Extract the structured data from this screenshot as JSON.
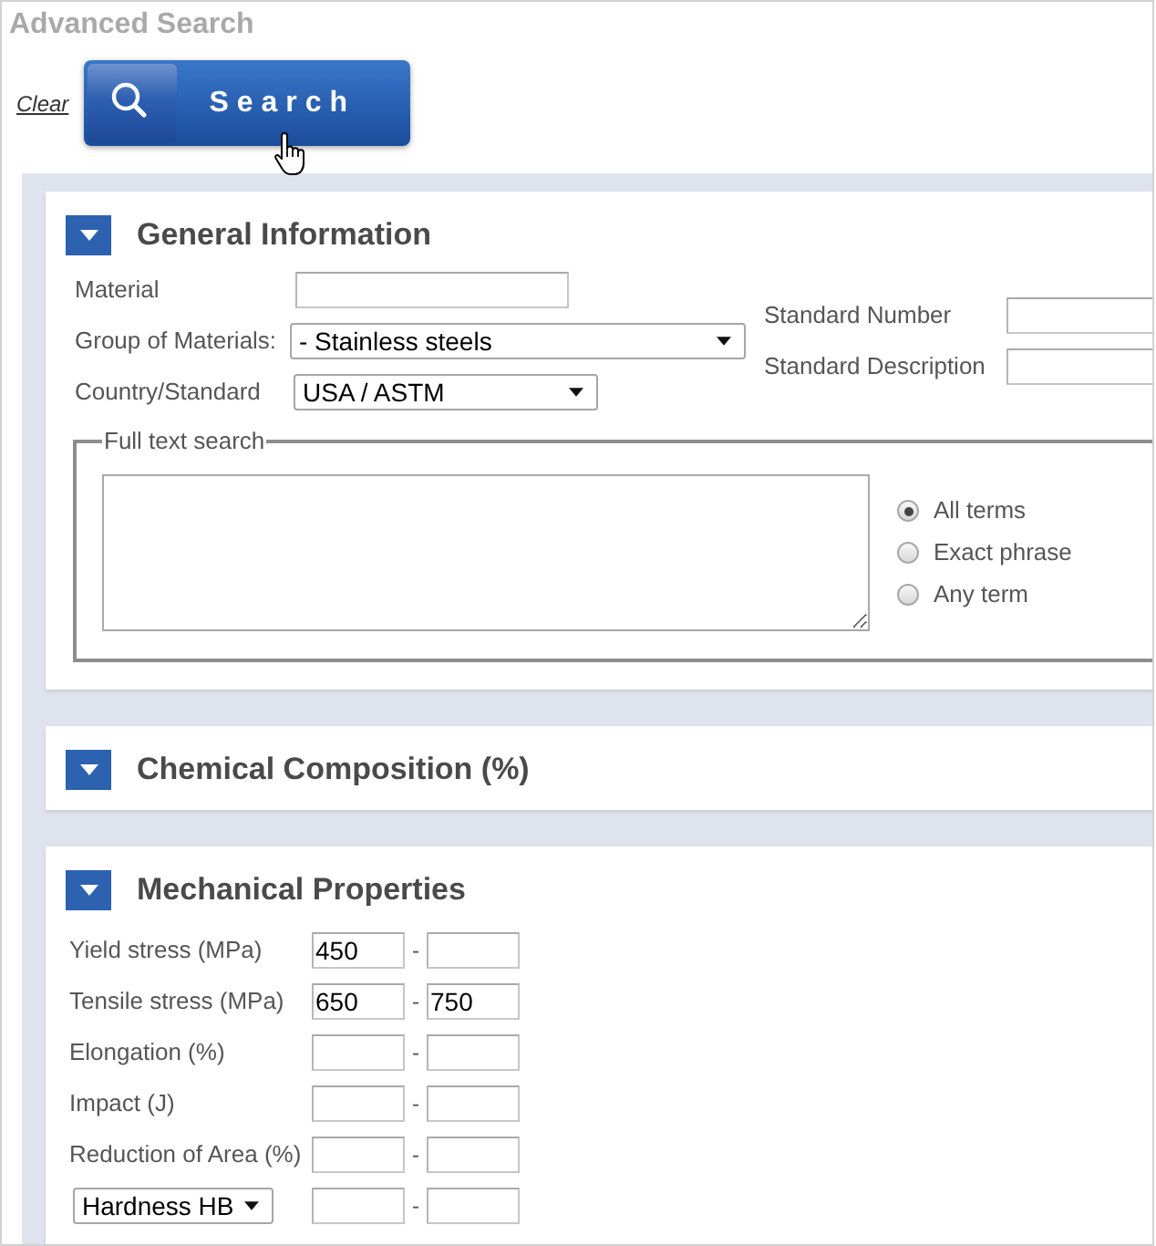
{
  "page": {
    "title": "Advanced Search"
  },
  "actions": {
    "clear_link": "Clear",
    "search_button": "Search"
  },
  "sections": [
    {
      "kind": "general",
      "title": "General Information",
      "fields": [
        {
          "kind": "text",
          "label": "Material"
        },
        {
          "kind": "select",
          "label": "Group of Materials:",
          "value": "- Stainless steels"
        },
        {
          "kind": "select",
          "label": "Country/Standard",
          "value": "USA / ASTM"
        }
      ],
      "standard_fields": [
        {
          "kind": "text",
          "label": "Standard Number"
        },
        {
          "kind": "text",
          "label": "Standard Description"
        }
      ],
      "full_text_search": {
        "legend": "Full text search",
        "options": [
          {
            "label": "All terms",
            "selected": true
          },
          {
            "label": "Exact phrase",
            "selected": false
          },
          {
            "label": "Any term",
            "selected": false
          }
        ]
      }
    },
    {
      "kind": "header_only",
      "title": "Chemical Composition (%)"
    },
    {
      "kind": "ranges",
      "title": "Mechanical Properties",
      "rows": [
        {
          "kind": "label",
          "label": "Yield stress (MPa)",
          "min": "450",
          "separator": "-"
        },
        {
          "kind": "label",
          "label": "Tensile stress (MPa)",
          "min": "650",
          "separator": "-",
          "max": "750"
        },
        {
          "kind": "label",
          "label": "Elongation (%)",
          "separator": "-"
        },
        {
          "kind": "label",
          "label": "Impact (J)",
          "separator": "-"
        },
        {
          "kind": "label",
          "label": "Reduction of Area (%)",
          "separator": "-"
        },
        {
          "kind": "select",
          "label": "Hardness HB",
          "separator": "-"
        }
      ]
    }
  ]
}
